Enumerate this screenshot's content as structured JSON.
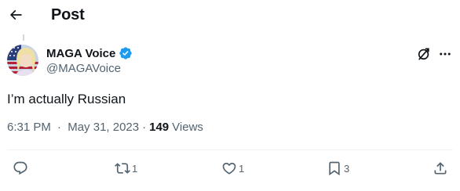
{
  "header": {
    "title": "Post",
    "back_icon": "arrow-left-icon"
  },
  "author": {
    "display_name": "MAGA Voice",
    "handle": "@MAGAVoice",
    "verified": true,
    "verified_color": "#1d9bf0"
  },
  "tweet": {
    "text": "I’m actually Russian"
  },
  "meta": {
    "time": "6:31 PM",
    "separator": "·",
    "date": "May 31, 2023",
    "views_count": "149",
    "views_label": "Views"
  },
  "actions": {
    "reply_count": "",
    "retweet_count": "1",
    "like_count": "1",
    "bookmark_count": "3"
  },
  "colors": {
    "text": "#0f1419",
    "secondary": "#536471",
    "border": "#eff3f4"
  }
}
